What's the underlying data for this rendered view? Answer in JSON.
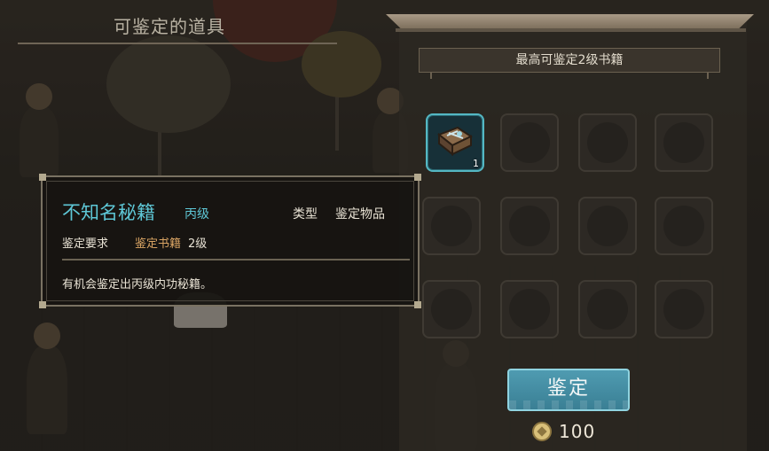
{
  "left_panel": {
    "title": "可鉴定的道具"
  },
  "right_panel": {
    "banner": "最高可鉴定2级书籍",
    "slots": [
      {
        "filled": true,
        "icon": "book-icon",
        "count": "1"
      },
      {
        "filled": false
      },
      {
        "filled": false
      },
      {
        "filled": false
      },
      {
        "filled": false
      },
      {
        "filled": false
      },
      {
        "filled": false
      },
      {
        "filled": false
      },
      {
        "filled": false
      },
      {
        "filled": false
      },
      {
        "filled": false
      },
      {
        "filled": false
      }
    ],
    "button_label": "鉴定",
    "cost": "100",
    "cost_icon": "coin-icon"
  },
  "tooltip": {
    "item_name": "不知名秘籍",
    "grade": "丙级",
    "type_label": "类型",
    "type_value": "鉴定物品",
    "requirement_label": "鉴定要求",
    "requirement_value": "鉴定书籍",
    "requirement_level": "2级",
    "description": "有机会鉴定出丙级内功秘籍。"
  },
  "colors": {
    "accent_cyan": "#5ec7d6",
    "requirement_orange": "#d9a464",
    "button_teal": "#4f9bb1"
  }
}
